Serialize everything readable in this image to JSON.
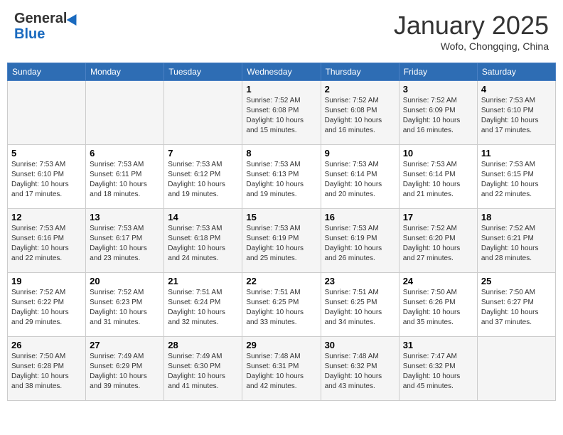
{
  "header": {
    "logo_general": "General",
    "logo_blue": "Blue",
    "title": "January 2025",
    "subtitle": "Wofo, Chongqing, China"
  },
  "days_of_week": [
    "Sunday",
    "Monday",
    "Tuesday",
    "Wednesday",
    "Thursday",
    "Friday",
    "Saturday"
  ],
  "weeks": [
    [
      {
        "day": "",
        "info": ""
      },
      {
        "day": "",
        "info": ""
      },
      {
        "day": "",
        "info": ""
      },
      {
        "day": "1",
        "info": "Sunrise: 7:52 AM\nSunset: 6:08 PM\nDaylight: 10 hours\nand 15 minutes."
      },
      {
        "day": "2",
        "info": "Sunrise: 7:52 AM\nSunset: 6:08 PM\nDaylight: 10 hours\nand 16 minutes."
      },
      {
        "day": "3",
        "info": "Sunrise: 7:52 AM\nSunset: 6:09 PM\nDaylight: 10 hours\nand 16 minutes."
      },
      {
        "day": "4",
        "info": "Sunrise: 7:53 AM\nSunset: 6:10 PM\nDaylight: 10 hours\nand 17 minutes."
      }
    ],
    [
      {
        "day": "5",
        "info": "Sunrise: 7:53 AM\nSunset: 6:10 PM\nDaylight: 10 hours\nand 17 minutes."
      },
      {
        "day": "6",
        "info": "Sunrise: 7:53 AM\nSunset: 6:11 PM\nDaylight: 10 hours\nand 18 minutes."
      },
      {
        "day": "7",
        "info": "Sunrise: 7:53 AM\nSunset: 6:12 PM\nDaylight: 10 hours\nand 19 minutes."
      },
      {
        "day": "8",
        "info": "Sunrise: 7:53 AM\nSunset: 6:13 PM\nDaylight: 10 hours\nand 19 minutes."
      },
      {
        "day": "9",
        "info": "Sunrise: 7:53 AM\nSunset: 6:14 PM\nDaylight: 10 hours\nand 20 minutes."
      },
      {
        "day": "10",
        "info": "Sunrise: 7:53 AM\nSunset: 6:14 PM\nDaylight: 10 hours\nand 21 minutes."
      },
      {
        "day": "11",
        "info": "Sunrise: 7:53 AM\nSunset: 6:15 PM\nDaylight: 10 hours\nand 22 minutes."
      }
    ],
    [
      {
        "day": "12",
        "info": "Sunrise: 7:53 AM\nSunset: 6:16 PM\nDaylight: 10 hours\nand 22 minutes."
      },
      {
        "day": "13",
        "info": "Sunrise: 7:53 AM\nSunset: 6:17 PM\nDaylight: 10 hours\nand 23 minutes."
      },
      {
        "day": "14",
        "info": "Sunrise: 7:53 AM\nSunset: 6:18 PM\nDaylight: 10 hours\nand 24 minutes."
      },
      {
        "day": "15",
        "info": "Sunrise: 7:53 AM\nSunset: 6:19 PM\nDaylight: 10 hours\nand 25 minutes."
      },
      {
        "day": "16",
        "info": "Sunrise: 7:53 AM\nSunset: 6:19 PM\nDaylight: 10 hours\nand 26 minutes."
      },
      {
        "day": "17",
        "info": "Sunrise: 7:52 AM\nSunset: 6:20 PM\nDaylight: 10 hours\nand 27 minutes."
      },
      {
        "day": "18",
        "info": "Sunrise: 7:52 AM\nSunset: 6:21 PM\nDaylight: 10 hours\nand 28 minutes."
      }
    ],
    [
      {
        "day": "19",
        "info": "Sunrise: 7:52 AM\nSunset: 6:22 PM\nDaylight: 10 hours\nand 29 minutes."
      },
      {
        "day": "20",
        "info": "Sunrise: 7:52 AM\nSunset: 6:23 PM\nDaylight: 10 hours\nand 31 minutes."
      },
      {
        "day": "21",
        "info": "Sunrise: 7:51 AM\nSunset: 6:24 PM\nDaylight: 10 hours\nand 32 minutes."
      },
      {
        "day": "22",
        "info": "Sunrise: 7:51 AM\nSunset: 6:25 PM\nDaylight: 10 hours\nand 33 minutes."
      },
      {
        "day": "23",
        "info": "Sunrise: 7:51 AM\nSunset: 6:25 PM\nDaylight: 10 hours\nand 34 minutes."
      },
      {
        "day": "24",
        "info": "Sunrise: 7:50 AM\nSunset: 6:26 PM\nDaylight: 10 hours\nand 35 minutes."
      },
      {
        "day": "25",
        "info": "Sunrise: 7:50 AM\nSunset: 6:27 PM\nDaylight: 10 hours\nand 37 minutes."
      }
    ],
    [
      {
        "day": "26",
        "info": "Sunrise: 7:50 AM\nSunset: 6:28 PM\nDaylight: 10 hours\nand 38 minutes."
      },
      {
        "day": "27",
        "info": "Sunrise: 7:49 AM\nSunset: 6:29 PM\nDaylight: 10 hours\nand 39 minutes."
      },
      {
        "day": "28",
        "info": "Sunrise: 7:49 AM\nSunset: 6:30 PM\nDaylight: 10 hours\nand 41 minutes."
      },
      {
        "day": "29",
        "info": "Sunrise: 7:48 AM\nSunset: 6:31 PM\nDaylight: 10 hours\nand 42 minutes."
      },
      {
        "day": "30",
        "info": "Sunrise: 7:48 AM\nSunset: 6:32 PM\nDaylight: 10 hours\nand 43 minutes."
      },
      {
        "day": "31",
        "info": "Sunrise: 7:47 AM\nSunset: 6:32 PM\nDaylight: 10 hours\nand 45 minutes."
      },
      {
        "day": "",
        "info": ""
      }
    ]
  ]
}
